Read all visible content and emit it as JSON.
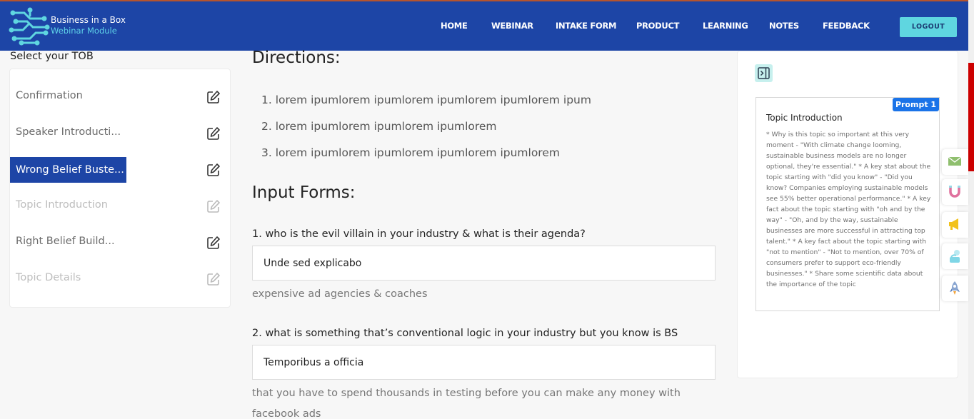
{
  "header": {
    "brand_title": "Business in a Box",
    "brand_subtitle": "Webinar Module",
    "nav": [
      "HOME",
      "WEBINAR",
      "INTAKE FORM",
      "PRODUCT",
      "LEARNING",
      "NOTES",
      "FEEDBACK"
    ],
    "logout_label": "LOGOUT"
  },
  "sidebar": {
    "title": "Select your TOB",
    "items": [
      {
        "label": "Confirmation",
        "state": "normal"
      },
      {
        "label": "Speaker Introducti...",
        "state": "normal"
      },
      {
        "label": "Wrong Belief Buste...",
        "state": "active"
      },
      {
        "label": "Topic Introduction",
        "state": "disabled"
      },
      {
        "label": "Right Belief Build...",
        "state": "normal"
      },
      {
        "label": "Topic Details",
        "state": "disabled"
      }
    ]
  },
  "main": {
    "directions_title": "Directions:",
    "directions": [
      "1. lorem ipumlorem ipumlorem ipumlorem ipumlorem ipum",
      "2. lorem ipumlorem ipumlorem ipumlorem",
      "3. lorem ipumlorem ipumlorem ipumlorem ipumlorem"
    ],
    "forms_title": "Input Forms:",
    "questions": [
      {
        "label": "1. who is the evil villain in your industry & what is their agenda?",
        "value": "Unde sed explicabo",
        "hint": "expensive ad agencies & coaches"
      },
      {
        "label": "2. what is something that’s conventional logic in your industry but you know is BS",
        "value": "Temporibus a officia",
        "hint": "that you have to spend thousands in testing before you can make any money with facebook ads"
      }
    ]
  },
  "prompt": {
    "badge": "Prompt 1",
    "heading": "Topic Introduction",
    "body": "* Why is this topic so important at this very moment - \"With climate change looming, sustainable business models are no longer optional, they're essential.\" * A key stat about the topic starting with \"did you know\" - \"Did you know? Companies employing sustainable models see 55% better operational performance.\" * A key fact about the topic starting with \"oh and by the way\" - \"Oh, and by the way, sustainable businesses are more successful in attracting top talent.\" * A key fact about the topic starting with \"not to mention\" - \"Not to mention, over 70% of consumers prefer to support eco-friendly businesses.\" * Share some scientific data about the importance of the topic"
  },
  "side_tabs": [
    "mail-icon",
    "magnet-icon",
    "megaphone-icon",
    "hand-icon",
    "rocket-icon"
  ],
  "colors": {
    "header_bg": "#1d45a6",
    "accent_cyan": "#5fd6e0",
    "active_item_bg": "#1d45a6",
    "prompt_badge": "#1a73e8",
    "scroll_accent": "#cc0000"
  }
}
